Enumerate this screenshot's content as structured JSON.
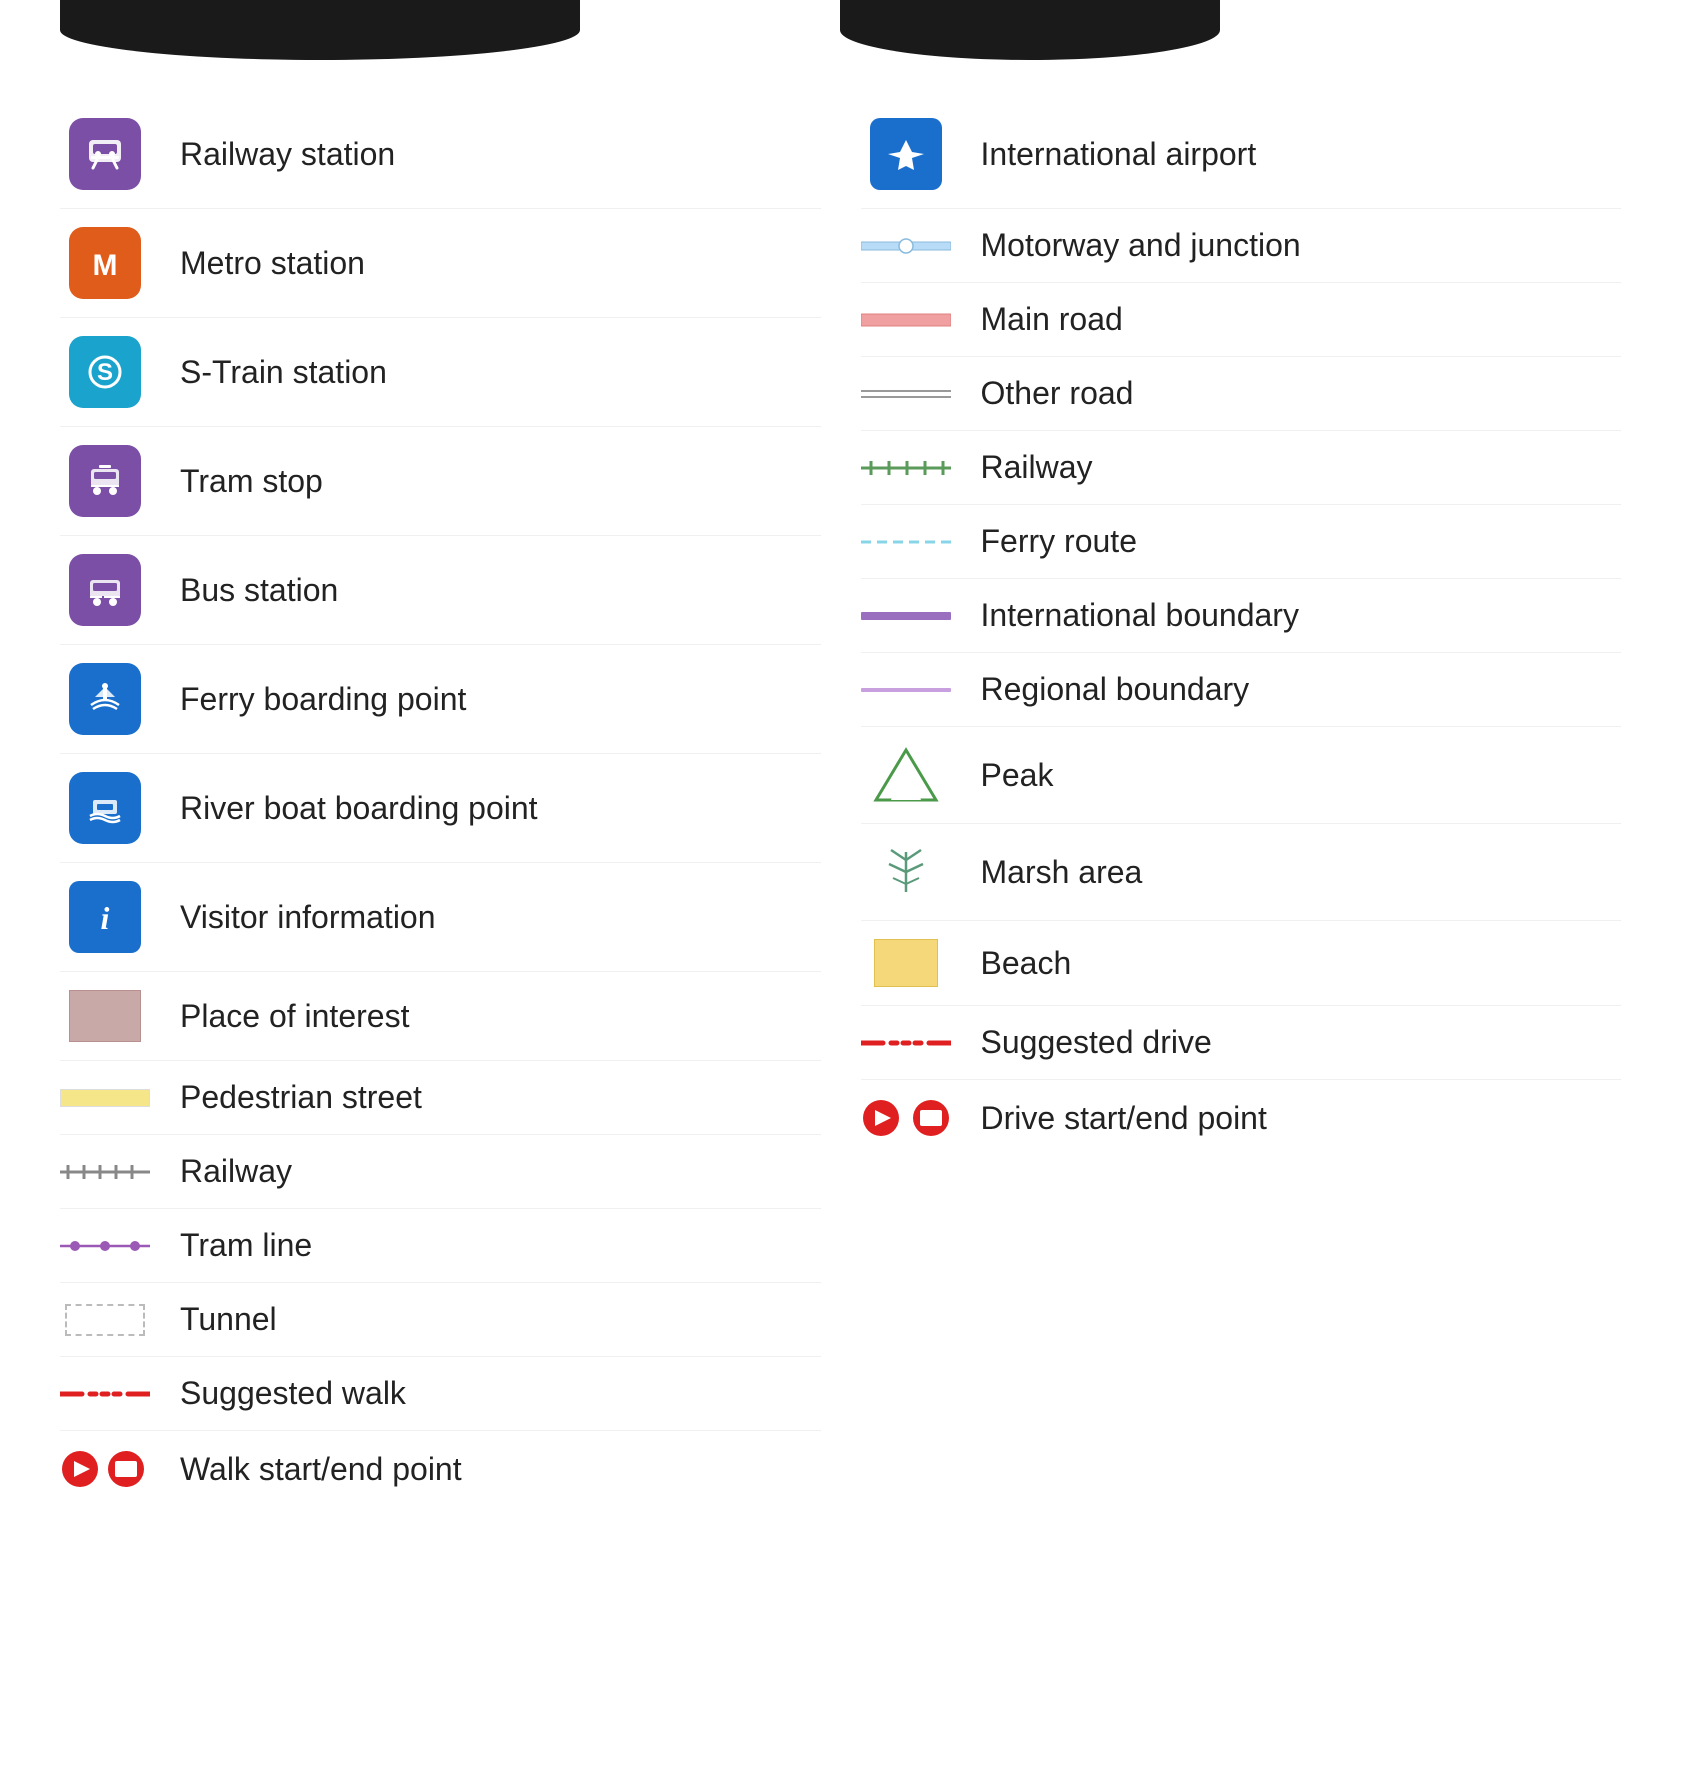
{
  "banners": {
    "left_visible": true,
    "right_visible": true
  },
  "left_column": [
    {
      "id": "railway-station",
      "label": "Railway station",
      "icon_type": "svg-railway"
    },
    {
      "id": "metro-station",
      "label": "Metro station",
      "icon_type": "svg-metro"
    },
    {
      "id": "s-train-station",
      "label": "S-Train station",
      "icon_type": "svg-strain"
    },
    {
      "id": "tram-stop",
      "label": "Tram stop",
      "icon_type": "svg-tram"
    },
    {
      "id": "bus-station",
      "label": "Bus station",
      "icon_type": "svg-bus"
    },
    {
      "id": "ferry-boarding",
      "label": "Ferry boarding point",
      "icon_type": "svg-ferry"
    },
    {
      "id": "river-boat",
      "label": "River boat boarding point",
      "icon_type": "svg-riverboat"
    },
    {
      "id": "visitor-info",
      "label": "Visitor information",
      "icon_type": "svg-info"
    },
    {
      "id": "place-of-interest",
      "label": "Place of interest",
      "icon_type": "poi-box"
    },
    {
      "id": "pedestrian-street",
      "label": "Pedestrian street",
      "icon_type": "pedestrian-line"
    },
    {
      "id": "railway-line",
      "label": "Railway",
      "icon_type": "railway-line"
    },
    {
      "id": "tram-line",
      "label": "Tram line",
      "icon_type": "tram-line"
    },
    {
      "id": "tunnel",
      "label": "Tunnel",
      "icon_type": "tunnel-box"
    },
    {
      "id": "suggested-walk",
      "label": "Suggested walk",
      "icon_type": "suggested-walk"
    },
    {
      "id": "walk-start-end",
      "label": "Walk start/end point",
      "icon_type": "walk-start-end"
    }
  ],
  "right_column": [
    {
      "id": "international-airport",
      "label": "International airport",
      "icon_type": "svg-airport"
    },
    {
      "id": "motorway",
      "label": "Motorway and junction",
      "icon_type": "motorway-line"
    },
    {
      "id": "main-road",
      "label": "Main road",
      "icon_type": "main-road-line"
    },
    {
      "id": "other-road",
      "label": "Other road",
      "icon_type": "other-road-line"
    },
    {
      "id": "railway-right",
      "label": "Railway",
      "icon_type": "railway-right-line"
    },
    {
      "id": "ferry-route",
      "label": "Ferry route",
      "icon_type": "ferry-route-line"
    },
    {
      "id": "intl-boundary",
      "label": "International boundary",
      "icon_type": "intl-boundary-line"
    },
    {
      "id": "regional-boundary",
      "label": "Regional boundary",
      "icon_type": "regional-boundary-line"
    },
    {
      "id": "peak",
      "label": "Peak",
      "icon_type": "peak-icon"
    },
    {
      "id": "marsh-area",
      "label": "Marsh area",
      "icon_type": "marsh-icon"
    },
    {
      "id": "beach",
      "label": "Beach",
      "icon_type": "beach-box"
    },
    {
      "id": "suggested-drive",
      "label": "Suggested drive",
      "icon_type": "suggested-drive"
    },
    {
      "id": "drive-start-end",
      "label": "Drive start/end point",
      "icon_type": "drive-start-end"
    }
  ]
}
